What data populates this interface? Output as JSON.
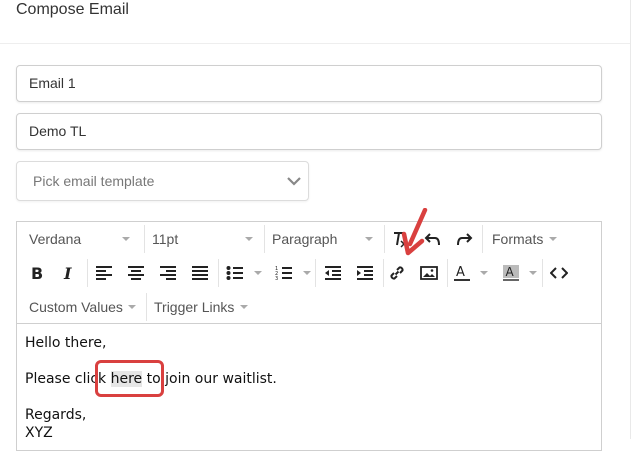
{
  "header": {
    "title": "Compose Email"
  },
  "form": {
    "email_name": {
      "value": "Email 1"
    },
    "subject": {
      "value": "Demo TL"
    },
    "template_select": {
      "placeholder": "Pick email template"
    }
  },
  "toolbar": {
    "font_family": "Verdana",
    "font_size": "11pt",
    "block_format": "Paragraph",
    "formats_label": "Formats",
    "custom_values_label": "Custom Values",
    "trigger_links_label": "Trigger Links",
    "icons": [
      "clear-formatting-icon",
      "undo-icon",
      "redo-icon",
      "bold-icon",
      "italic-icon",
      "align-left-icon",
      "align-center-icon",
      "align-right-icon",
      "align-justify-icon",
      "bullet-list-icon",
      "numbered-list-icon",
      "outdent-icon",
      "indent-icon",
      "link-icon",
      "image-icon",
      "text-color-icon",
      "background-color-icon",
      "source-code-icon"
    ]
  },
  "editor_content": {
    "greeting": "Hello there,",
    "line_before": "Please click ",
    "link_text": "here",
    "line_after": " to join our waitlist.",
    "closing": "Regards,",
    "signature": "XYZ"
  },
  "annotations": {
    "highlight_color": "#d9403f",
    "arrow_color": "#d9403f"
  }
}
